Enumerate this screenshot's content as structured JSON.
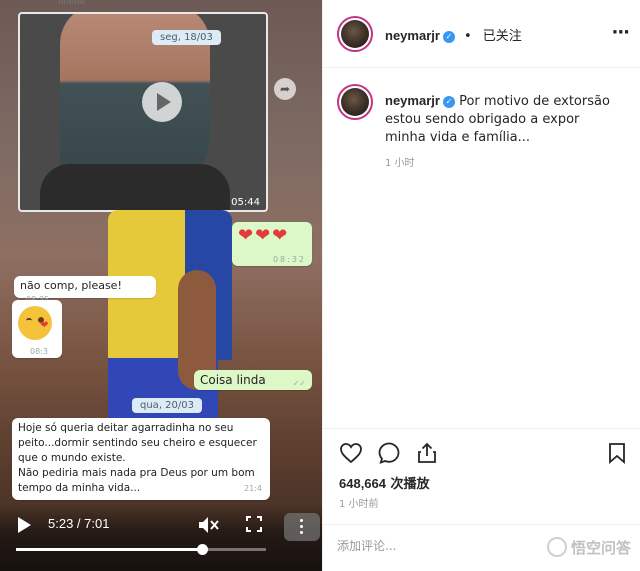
{
  "video": {
    "chat": {
      "online_status": "online",
      "date_1": "seg, 18/03",
      "video_duration": "05:44",
      "hearts": "❤❤❤",
      "hearts_time": "08:32",
      "msg_nao_comp": "não comp, please!",
      "msg_nao_comp_time": "08:35",
      "msg_emoji_time": "08:3",
      "msg_coisa_linda": "Coisa linda",
      "date_2": "qua, 20/03",
      "msg_long": "Hoje só queria deitar agarradinha no seu peito...dormir sentindo seu cheiro e esquecer que o mundo existe.\nNão pediria mais nada pra Deus por um bom tempo da minha vida...",
      "msg_long_time": "21:4"
    },
    "controls": {
      "time_display": "5:23 / 7:01",
      "progress_fraction": 0.7458
    }
  },
  "post": {
    "username": "neymarjr",
    "follow_state": "已关注",
    "separator": "•",
    "caption": "Por motivo de extorsão estou sendo obrigado a expor minha vida e família...",
    "caption_time": "1 小时",
    "likes_count": "648,664",
    "likes_suffix": " 次播放",
    "post_time": "1 小时前",
    "comment_placeholder": "添加评论...",
    "watermark": "悟空问答"
  },
  "colors": {
    "verified": "#3897f0",
    "story_ring": "#c13584",
    "whatsapp_out": "#dcf8c6"
  }
}
